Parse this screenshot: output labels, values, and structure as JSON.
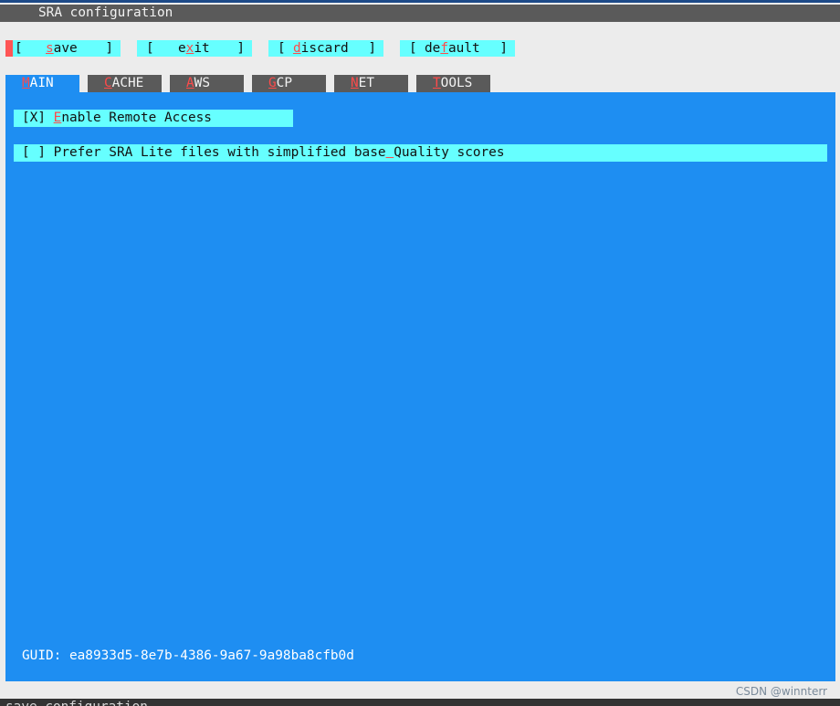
{
  "window": {
    "title": "SRA configuration",
    "status_line": "save configuration"
  },
  "buttons": [
    {
      "label": "save",
      "hotkey_index": 0
    },
    {
      "label": "exit",
      "hotkey_index": 1
    },
    {
      "label": "discard",
      "hotkey_index": 0
    },
    {
      "label": "default",
      "hotkey_index": 2
    }
  ],
  "tabs": [
    {
      "label": "MAIN",
      "hotkey_index": 0,
      "active": true
    },
    {
      "label": "CACHE",
      "hotkey_index": 0,
      "active": false
    },
    {
      "label": "AWS",
      "hotkey_index": 0,
      "active": false
    },
    {
      "label": "GCP",
      "hotkey_index": 0,
      "active": false
    },
    {
      "label": "NET",
      "hotkey_index": 0,
      "active": false
    },
    {
      "label": "TOOLS",
      "hotkey_index": 0,
      "active": false
    }
  ],
  "main": {
    "options": [
      {
        "mark": "[X]",
        "label": "Enable Remote Access",
        "hotkey_index": 0,
        "checked": true
      },
      {
        "mark": "[ ]",
        "label": "Prefer SRA Lite files with simplified base Quality scores",
        "hotkey_index": 42,
        "checked": false
      }
    ],
    "guid": "GUID: ea8933d5-8e7b-4386-9a67-9a98ba8cfb0d"
  },
  "watermark": "CSDN @winnterr",
  "colors": {
    "panel": "#1e8ef2",
    "button_bg": "#66ffff",
    "hotkey": "#ff4a4a",
    "title_bar": "#5a5a5a"
  }
}
